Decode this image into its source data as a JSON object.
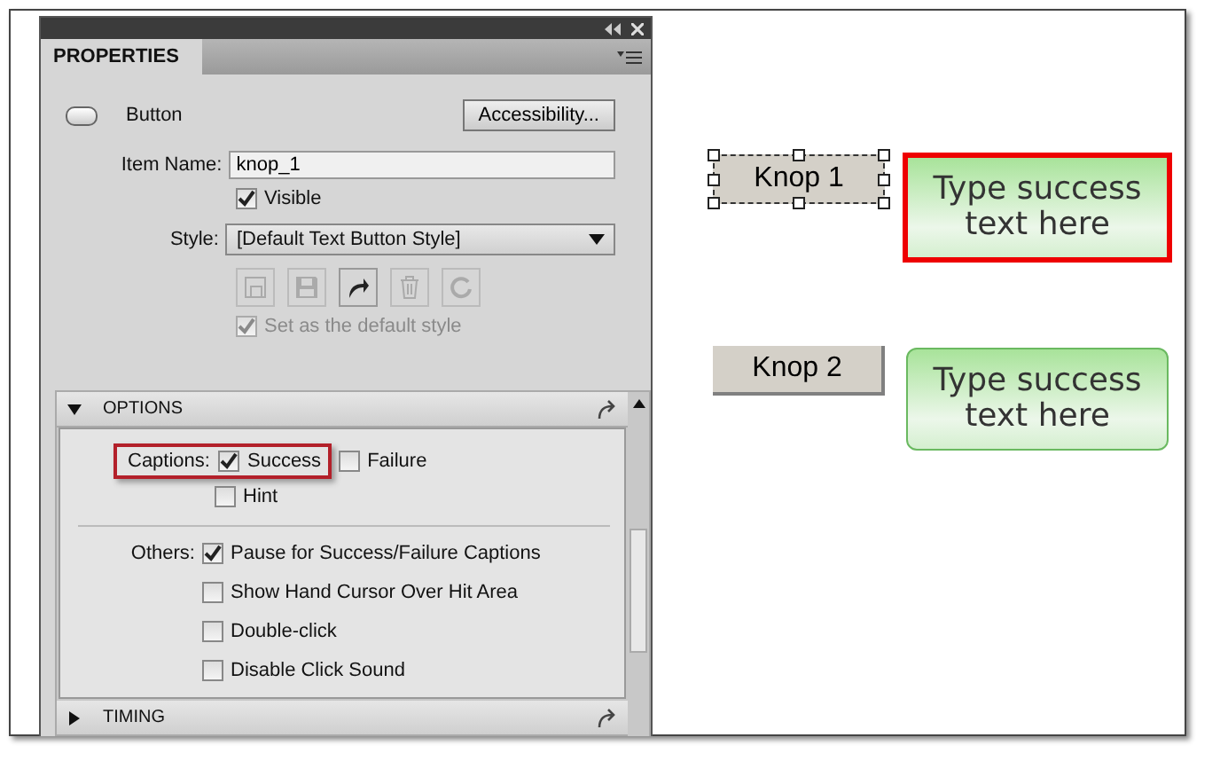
{
  "panel": {
    "title": "PROPERTIES",
    "object_type": "Button",
    "accessibility_button": "Accessibility...",
    "item_name": {
      "label": "Item Name:",
      "value": "knop_1"
    },
    "visible": {
      "label": "Visible",
      "checked": true
    },
    "style": {
      "label": "Style:",
      "value": "[Default Text Button Style]"
    },
    "style_tools": [
      {
        "kind": "new",
        "disabled": true
      },
      {
        "kind": "save",
        "disabled": true
      },
      {
        "kind": "apply",
        "disabled": false
      },
      {
        "kind": "delete",
        "disabled": true
      },
      {
        "kind": "reset",
        "disabled": true
      }
    ],
    "default_style": {
      "label": "Set as the default style",
      "checked": true,
      "disabled": true
    },
    "options": {
      "title": "OPTIONS",
      "expanded": true,
      "captions": {
        "label": "Captions:",
        "highlighted": true,
        "items": [
          {
            "label": "Success",
            "checked": true
          },
          {
            "label": "Failure",
            "checked": false
          },
          {
            "label": "Hint",
            "checked": false
          }
        ]
      },
      "others": {
        "label": "Others:",
        "items": [
          {
            "label": "Pause for Success/Failure Captions",
            "checked": true
          },
          {
            "label": "Show Hand Cursor Over Hit Area",
            "checked": false
          },
          {
            "label": "Double-click",
            "checked": false
          },
          {
            "label": "Disable Click Sound",
            "checked": false
          }
        ]
      }
    },
    "timing": {
      "title": "TIMING",
      "expanded": false
    }
  },
  "stage": [
    {
      "button": "Knop 1",
      "selected": true,
      "caption": "Type success text here",
      "caption_highlighted": true
    },
    {
      "button": "Knop 2",
      "selected": false,
      "caption": "Type success text here",
      "caption_highlighted": false
    }
  ]
}
